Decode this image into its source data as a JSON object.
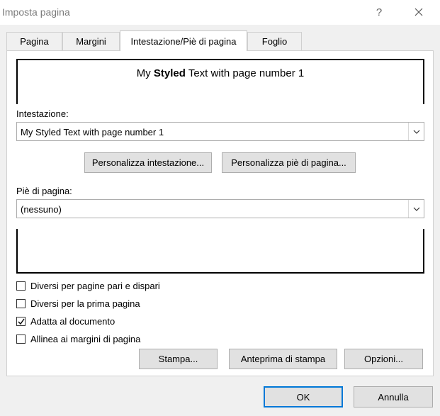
{
  "window": {
    "title": "Imposta pagina",
    "help_label": "?"
  },
  "tabs": [
    {
      "label": "Pagina",
      "active": false
    },
    {
      "label": "Margini",
      "active": false
    },
    {
      "label": "Intestazione/Piè di pagina",
      "active": true
    },
    {
      "label": "Foglio",
      "active": false
    }
  ],
  "header_preview": {
    "prefix": "My ",
    "bold": "Styled",
    "suffix": " Text with page number 1"
  },
  "header": {
    "label": "Intestazione:",
    "value": "My Styled Text with page number 1"
  },
  "buttons": {
    "custom_header": "Personalizza intestazione...",
    "custom_footer": "Personalizza piè di pagina...",
    "print": "Stampa...",
    "print_preview": "Anteprima di stampa",
    "options": "Opzioni...",
    "ok": "OK",
    "cancel": "Annulla"
  },
  "footer": {
    "label": "Piè di pagina:",
    "value": "(nessuno)"
  },
  "checkboxes": [
    {
      "label": "Diversi per pagine pari e dispari",
      "checked": false
    },
    {
      "label": "Diversi per la prima pagina",
      "checked": false
    },
    {
      "label": "Adatta al documento",
      "checked": true
    },
    {
      "label": "Allinea ai margini di pagina",
      "checked": false
    }
  ],
  "icons": {
    "close": "close-icon",
    "dropdown": "chevron-down-icon",
    "check": "checkmark-icon"
  }
}
